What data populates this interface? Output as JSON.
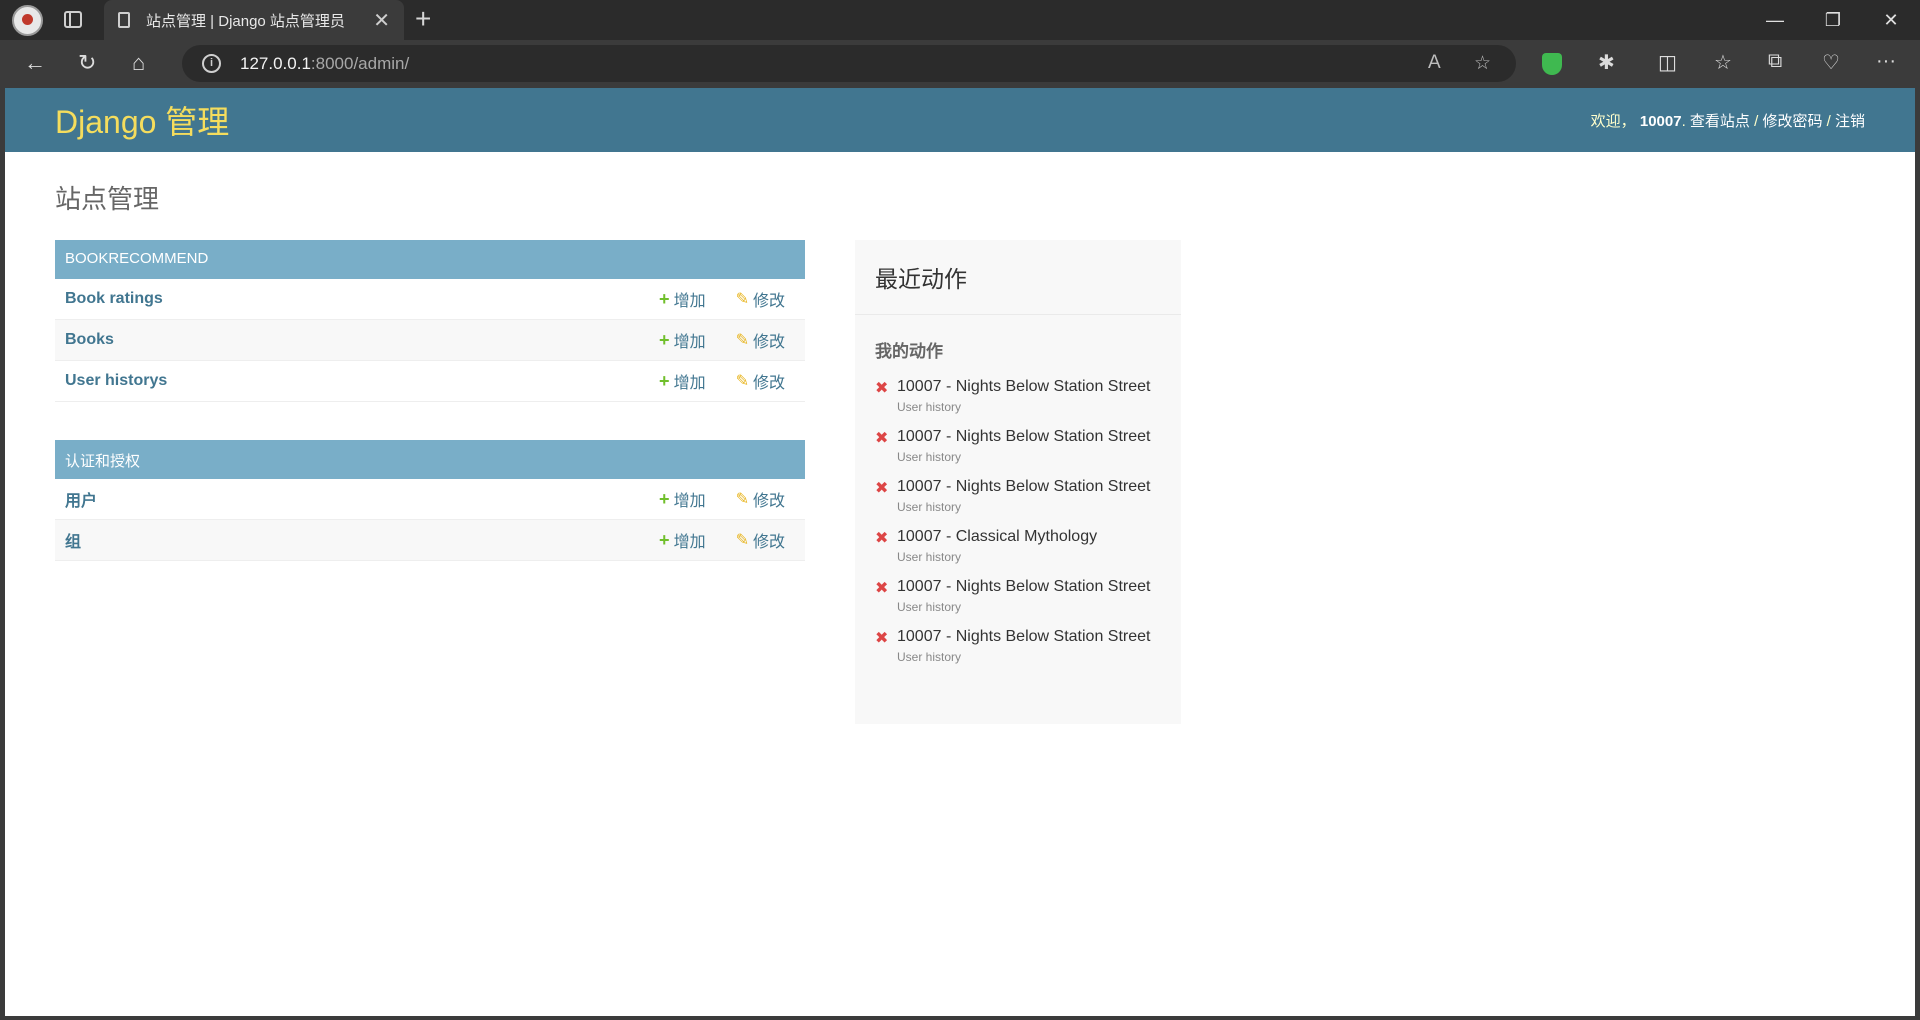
{
  "browser": {
    "tab_title": "站点管理 | Django 站点管理员",
    "url_host": "127.0.0.1",
    "url_path": ":8000/admin/"
  },
  "header": {
    "brand": "Django 管理",
    "welcome": "欢迎，",
    "username": "10007",
    "view_site": "查看站点",
    "change_password": "修改密码",
    "logout": "注销",
    "sep": " / "
  },
  "main": {
    "title": "站点管理",
    "modules": [
      {
        "caption": "BOOKRECOMMEND",
        "models": [
          {
            "name": "Book ratings",
            "add": "增加",
            "change": "修改"
          },
          {
            "name": "Books",
            "add": "增加",
            "change": "修改"
          },
          {
            "name": "User historys",
            "add": "增加",
            "change": "修改"
          }
        ]
      },
      {
        "caption": "认证和授权",
        "models": [
          {
            "name": "用户",
            "add": "增加",
            "change": "修改"
          },
          {
            "name": "组",
            "add": "增加",
            "change": "修改"
          }
        ]
      }
    ]
  },
  "recent": {
    "title": "最近动作",
    "subtitle": "我的动作",
    "actions": [
      {
        "text": "10007 - Nights Below Station Street",
        "type": "User history"
      },
      {
        "text": "10007 - Nights Below Station Street",
        "type": "User history"
      },
      {
        "text": "10007 - Nights Below Station Street",
        "type": "User history"
      },
      {
        "text": "10007 - Classical Mythology",
        "type": "User history"
      },
      {
        "text": "10007 - Nights Below Station Street",
        "type": "User history"
      },
      {
        "text": "10007 - Nights Below Station Street",
        "type": "User history"
      }
    ]
  },
  "colors": {
    "header_bg": "#417690",
    "brand": "#f5dd5d",
    "module_caption": "#79aec8",
    "link": "#417690",
    "add_icon": "#70bf2b",
    "change_icon": "#e8b520",
    "delete_icon": "#dd4646"
  }
}
